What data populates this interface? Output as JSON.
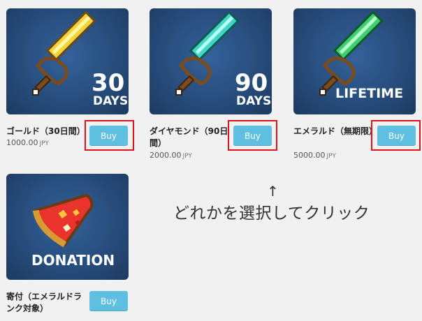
{
  "products": [
    {
      "name": "ゴールド（30日間）",
      "price": "1000.00",
      "currency": "JPY",
      "buy_label": "Buy",
      "badge_number": "30",
      "badge_text": "DAYS",
      "blade_color": "#f4d23a",
      "blade_light": "#fff6a0"
    },
    {
      "name": "ダイヤモンド（90日間）",
      "price": "2000.00",
      "currency": "JPY",
      "buy_label": "Buy",
      "badge_number": "90",
      "badge_text": "DAYS",
      "blade_color": "#3fd6c4",
      "blade_light": "#b8fff4"
    },
    {
      "name": "エメラルド（無期限）",
      "price": "5000.00",
      "currency": "JPY",
      "buy_label": "Buy",
      "badge_text": "LIFETIME",
      "blade_color": "#3fcf72",
      "blade_light": "#b6ffc9"
    },
    {
      "name": "寄付（エメラルドランク対象）",
      "buy_label": "Buy",
      "badge_text": "DONATION"
    }
  ],
  "annotation": {
    "arrow": "↑",
    "text": "どれかを選択してクリック",
    "highlight_color": "#e0121a"
  },
  "colors": {
    "button": "#5ebfe0",
    "card_bg": "#274d7c",
    "page_bg": "#f1f1f1"
  }
}
